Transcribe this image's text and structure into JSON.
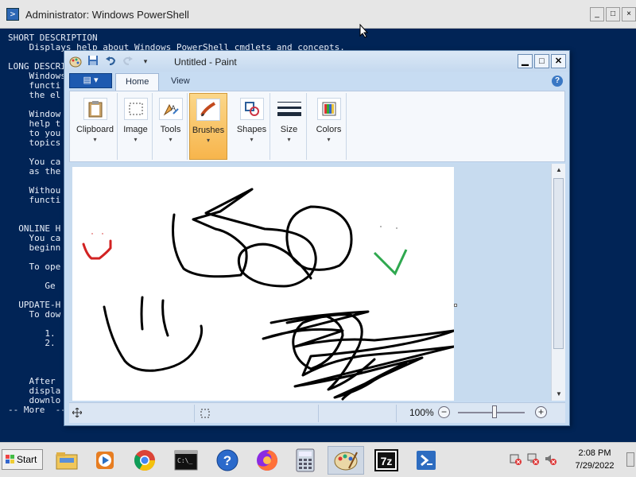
{
  "powershell": {
    "title": "Administrator: Windows PowerShell",
    "lines": [
      "SHORT DESCRIPTION",
      "    Displays help about Windows PowerShell cmdlets and concepts.",
      "",
      "LONG DESCRIPTION",
      "    Windows",
      "    functi",
      "    the el",
      "",
      "    Window",
      "    help t",
      "    to you",
      "    topics",
      "",
      "    You ca",
      "    as the",
      "",
      "    Withou",
      "    functi",
      "",
      "",
      "  ONLINE H",
      "    You ca",
      "    beginn",
      "",
      "    To ope",
      "",
      "       Ge",
      "",
      "  UPDATE-H",
      "    To dow",
      "",
      "       1.",
      "       2.",
      "",
      "",
      "",
      "    After",
      "    displa",
      "    downlo",
      "-- More  --"
    ],
    "controls": {
      "minimize": "_",
      "maximize": "□",
      "close": "×"
    }
  },
  "paint": {
    "title": "Untitled - Paint",
    "file_menu_label": "▤ ▾",
    "tabs": [
      {
        "label": "Home",
        "active": true
      },
      {
        "label": "View",
        "active": false
      }
    ],
    "help": "?",
    "ribbon_groups": [
      {
        "label": "Clipboard",
        "icon": "clipboard-icon"
      },
      {
        "label": "Image",
        "icon": "image-select-icon"
      },
      {
        "label": "Tools",
        "icon": "tools-icon"
      },
      {
        "label": "Brushes",
        "icon": "brushes-icon",
        "selected": true
      },
      {
        "label": "Shapes",
        "icon": "shapes-icon"
      },
      {
        "label": "Size",
        "icon": "size-icon"
      },
      {
        "label": "Colors",
        "icon": "colors-icon"
      }
    ],
    "dropdown_arrow": "▾",
    "status": {
      "zoom": "100%",
      "zoom_minus": "−",
      "zoom_plus": "+",
      "zoom_level_percent": 100
    },
    "controls": {
      "minimize": "▁",
      "maximize": "□",
      "close": "✕"
    },
    "colors": {
      "stroke_black": "#000000",
      "stroke_red": "#d22222",
      "stroke_green": "#2fa84f"
    }
  },
  "taskbar": {
    "start_label": "Start",
    "apps": [
      "file-explorer-icon",
      "media-player-icon",
      "chrome-icon",
      "command-prompt-icon",
      "help-icon",
      "firefox-icon",
      "calculator-icon",
      "paint-icon",
      "7zip-icon",
      "powershell-icon"
    ],
    "clock_time": "2:08 PM",
    "clock_date": "7/29/2022"
  }
}
